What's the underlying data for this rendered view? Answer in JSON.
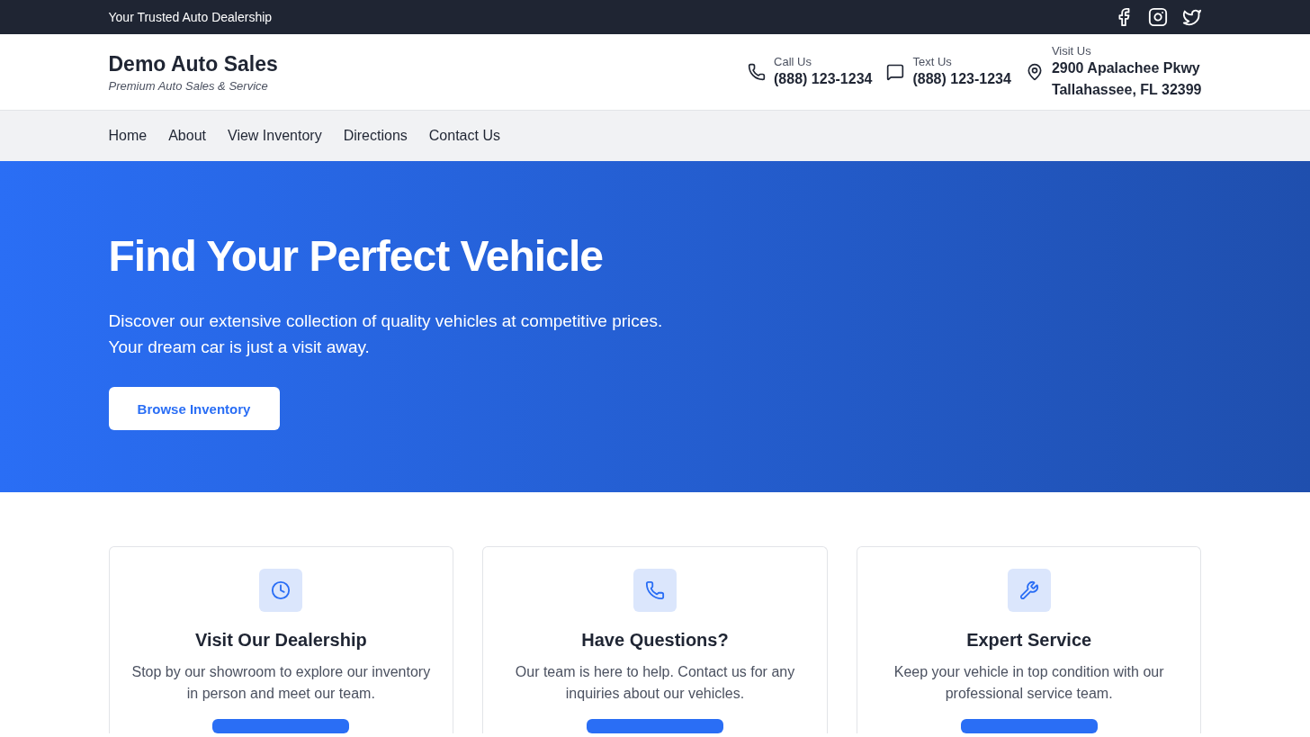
{
  "top_bar": {
    "tagline": "Your Trusted Auto Dealership",
    "social": [
      {
        "kind": "facebook"
      },
      {
        "kind": "instagram"
      },
      {
        "kind": "twitter"
      }
    ]
  },
  "header": {
    "brand": "Demo Auto Sales",
    "subtitle": "Premium Auto Sales & Service",
    "contacts": [
      {
        "kind": "phone",
        "label": "Call Us",
        "lines": [
          "(888) 123-1234"
        ]
      },
      {
        "kind": "message",
        "label": "Text Us",
        "lines": [
          "(888) 123-1234"
        ]
      },
      {
        "kind": "location",
        "label": "Visit Us",
        "lines": [
          "2900 Apalachee Pkwy",
          "Tallahassee, FL 32399"
        ]
      }
    ]
  },
  "nav": {
    "items": [
      "Home",
      "About",
      "View Inventory",
      "Directions",
      "Contact Us"
    ]
  },
  "hero": {
    "title": "Find Your Perfect Vehicle",
    "text_lines": [
      "Discover our extensive collection of quality vehicles at competitive prices.",
      "Your dream car is just a visit away."
    ],
    "button": "Browse Inventory"
  },
  "cards": [
    {
      "kind": "clock",
      "title": "Visit Our Dealership",
      "text": "Stop by our showroom to explore our inventory in person and meet our team."
    },
    {
      "kind": "phone",
      "title": "Have Questions?",
      "text": "Our team is here to help. Contact us for any inquiries about our vehicles."
    },
    {
      "kind": "wrench",
      "title": "Expert Service",
      "text": "Keep your vehicle in top condition with our professional service team."
    }
  ]
}
